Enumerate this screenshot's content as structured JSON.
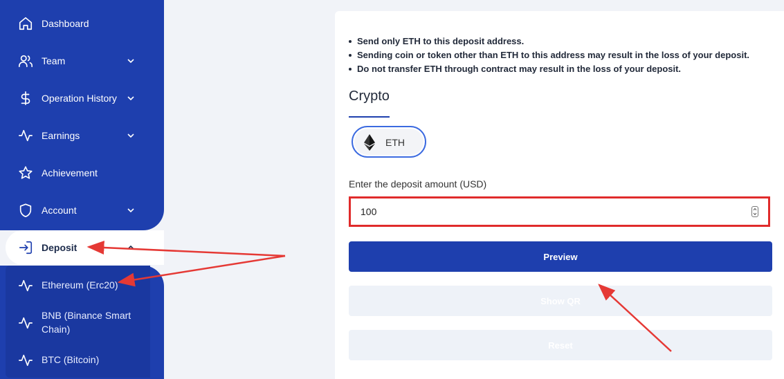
{
  "sidebar": {
    "items": [
      {
        "label": "Dashboard",
        "icon": "home-icon"
      },
      {
        "label": "Team",
        "icon": "users-icon"
      },
      {
        "label": "Operation History",
        "icon": "dollar-icon"
      },
      {
        "label": "Earnings",
        "icon": "activity-icon"
      },
      {
        "label": "Achievement",
        "icon": "star-icon"
      },
      {
        "label": "Account",
        "icon": "shield-icon"
      }
    ],
    "deposit": {
      "label": "Deposit",
      "icon": "sign-in-icon"
    },
    "deposit_sub": [
      {
        "label": "Ethereum (Erc20)",
        "icon": "activity-icon"
      },
      {
        "label": "BNB (Binance Smart Chain)",
        "icon": "activity-icon"
      },
      {
        "label": "BTC (Bitcoin)",
        "icon": "activity-icon"
      }
    ]
  },
  "main": {
    "notes": [
      "Send only ETH to this deposit address.",
      "Sending coin or token other than ETH to this address may result in the loss of your deposit.",
      "Do not transfer ETH through contract may result in the loss of your deposit."
    ],
    "crypto_title": "Crypto",
    "coin": {
      "label": "ETH",
      "icon": "ethereum-icon"
    },
    "amount_label": "Enter the deposit amount (USD)",
    "amount_value": "100",
    "preview_label": "Preview",
    "show_qr_label": "Show QR",
    "reset_label": "Reset"
  },
  "colors": {
    "sidebar": "#1e3fae",
    "primary_button": "#1e3fae",
    "highlight_border": "#e02b2b",
    "annotation_arrow": "#e53935"
  }
}
